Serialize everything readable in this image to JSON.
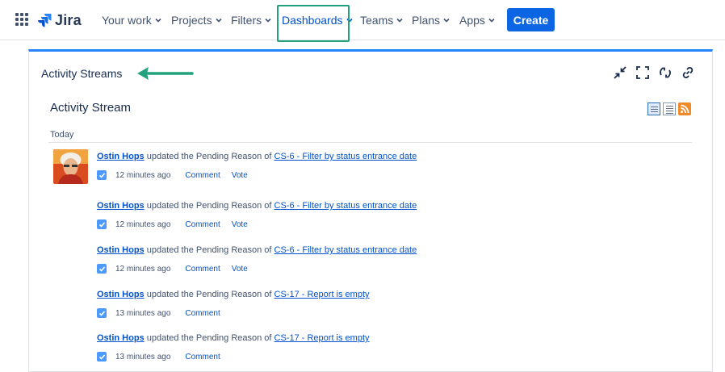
{
  "nav": {
    "logo_text": "Jira",
    "items": [
      {
        "label": "Your work"
      },
      {
        "label": "Projects"
      },
      {
        "label": "Filters"
      },
      {
        "label": "Dashboards"
      },
      {
        "label": "Teams"
      },
      {
        "label": "Plans"
      },
      {
        "label": "Apps"
      }
    ],
    "create_label": "Create"
  },
  "gadget": {
    "title": "Activity Streams",
    "icons": [
      "minimize-icon",
      "fullscreen-icon",
      "refresh-icon",
      "link-icon"
    ]
  },
  "stream": {
    "title": "Activity Stream",
    "view_icons": [
      "full-view-icon",
      "list-view-icon",
      "rss-icon"
    ],
    "group": "Today",
    "entries": [
      {
        "user": "Ostin Hops",
        "text": " updated the Pending Reason of ",
        "issue": "CS-6 - Filter by status entrance date",
        "time": "12 minutes ago",
        "comment": "Comment",
        "vote": "Vote"
      },
      {
        "user": "Ostin Hops",
        "text": " updated the Pending Reason of ",
        "issue": "CS-6 - Filter by status entrance date",
        "time": "12 minutes ago",
        "comment": "Comment",
        "vote": "Vote"
      },
      {
        "user": "Ostin Hops",
        "text": " updated the Pending Reason of ",
        "issue": "CS-6 - Filter by status entrance date",
        "time": "12 minutes ago",
        "comment": "Comment",
        "vote": "Vote"
      },
      {
        "user": "Ostin Hops",
        "text": " updated the Pending Reason of ",
        "issue": "CS-17 - Report is empty",
        "time": "13 minutes ago",
        "comment": "Comment"
      },
      {
        "user": "Ostin Hops",
        "text": " updated the Pending Reason of ",
        "issue": "CS-17 - Report is empty",
        "time": "13 minutes ago",
        "comment": "Comment"
      }
    ]
  },
  "colors": {
    "accent": "#0c66e4",
    "highlight": "#21a27c",
    "gadget_top": "#2684ff"
  }
}
